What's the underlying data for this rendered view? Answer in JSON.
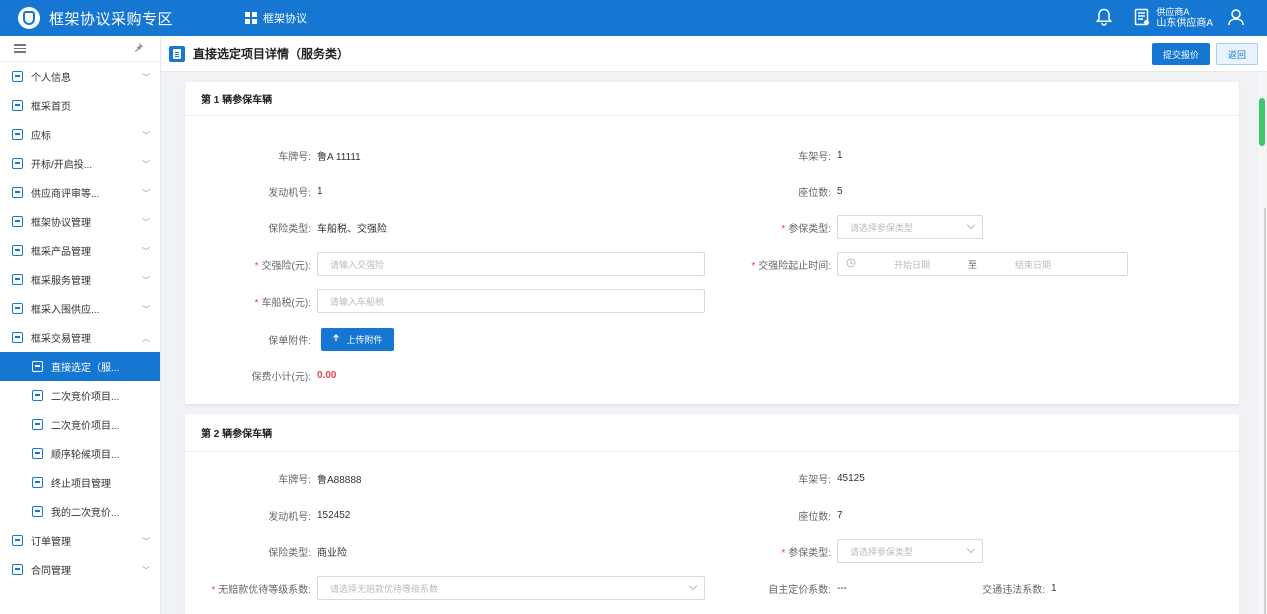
{
  "app": {
    "title": "框架协议采购专区",
    "nav_link": "框架协议"
  },
  "user": {
    "role": "供应商A",
    "name": "山东供应商A"
  },
  "sidebar": {
    "items": [
      {
        "label": "个人信息",
        "chevron": "﹀"
      },
      {
        "label": "框采首页",
        "chevron": ""
      },
      {
        "label": "应标",
        "chevron": "﹀"
      },
      {
        "label": "开标/开启投...",
        "chevron": "﹀"
      },
      {
        "label": "供应商评审等...",
        "chevron": "﹀"
      },
      {
        "label": "框架协议管理",
        "chevron": "﹀"
      },
      {
        "label": "框采产品管理",
        "chevron": "﹀"
      },
      {
        "label": "框采服务管理",
        "chevron": "﹀"
      },
      {
        "label": "框采入围供应...",
        "chevron": "﹀"
      },
      {
        "label": "框采交易管理",
        "chevron": "︿"
      },
      {
        "label": "直接选定（服...",
        "chevron": ""
      },
      {
        "label": "二次竞价项目...",
        "chevron": ""
      },
      {
        "label": "二次竞价项目...",
        "chevron": ""
      },
      {
        "label": "顺序轮候项目...",
        "chevron": ""
      },
      {
        "label": "终止项目管理",
        "chevron": ""
      },
      {
        "label": "我的二次竞价...",
        "chevron": ""
      },
      {
        "label": "订单管理",
        "chevron": "﹀"
      },
      {
        "label": "合同管理",
        "chevron": "﹀"
      }
    ]
  },
  "page": {
    "title": "直接选定项目详情（服务类）",
    "submit_label": "提交报价",
    "back_label": "返回"
  },
  "vehicle1": {
    "title": "第 1 辆参保车辆",
    "plate_label": "车牌号:",
    "plate": "鲁A 11111",
    "frame_label": "车架号:",
    "frame": "1",
    "engine_label": "发动机号:",
    "engine": "1",
    "seats_label": "座位数:",
    "seats": "5",
    "ins_type_label": "保险类型:",
    "ins_type": "车船税、交强险",
    "coverage_label": "参保类型:",
    "coverage_placeholder": "请选择参保类型",
    "jqx_label": "交强险(元):",
    "jqx_placeholder": "请输入交强险",
    "jqx_time_label": "交强险起止时间:",
    "start_placeholder": "开始日期",
    "to": "至",
    "end_placeholder": "结束日期",
    "ccs_label": "车船税(元):",
    "ccs_placeholder": "请输入车船税",
    "attach_label": "保单附件:",
    "upload_label": "上传附件",
    "subtotal_label": "保费小计(元):",
    "subtotal": "0.00"
  },
  "vehicle2": {
    "title": "第 2 辆参保车辆",
    "plate_label": "车牌号:",
    "plate": "鲁A88888",
    "frame_label": "车架号:",
    "frame": "45125",
    "engine_label": "发动机号:",
    "engine": "152452",
    "seats_label": "座位数:",
    "seats": "7",
    "ins_type_label": "保险类型:",
    "ins_type": "商业险",
    "coverage_label": "参保类型:",
    "coverage_placeholder": "请选择参保类型",
    "ncd_label": "无赔款优待等级系数:",
    "ncd_placeholder": "请选择无赔款优待等级系数",
    "self_label": "自主定价系数:",
    "self_value": "---",
    "traffic_label": "交通违法系数:",
    "traffic_value": "1"
  }
}
